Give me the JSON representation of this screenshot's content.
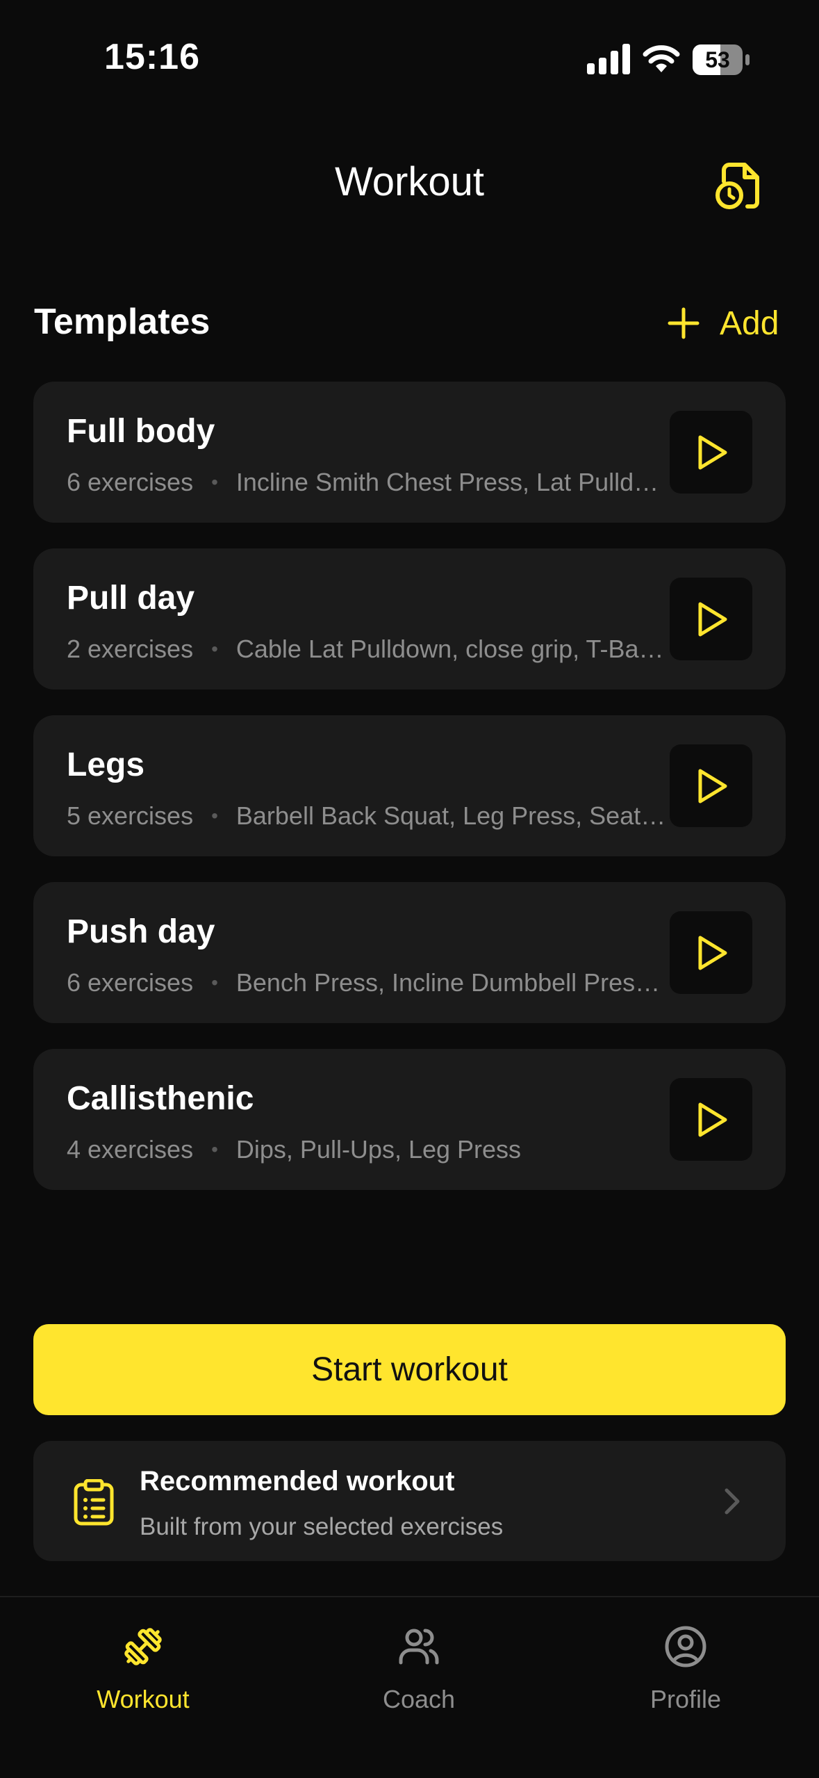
{
  "status_bar": {
    "time": "15:16",
    "battery_level": "53"
  },
  "header": {
    "title": "Workout",
    "history_icon": "file-clock-icon"
  },
  "templates_section": {
    "title": "Templates",
    "add_label": "Add"
  },
  "templates": [
    {
      "name": "Full body",
      "count": "6 exercises",
      "exercises": "Incline Smith Chest Press, Lat Pulldown, Barbell Back Squat, Seated Row, Shoulder Press, Leg Press"
    },
    {
      "name": "Pull day",
      "count": "2 exercises",
      "exercises": "Cable Lat Pulldown, close grip, T-Bar Row"
    },
    {
      "name": "Legs",
      "count": "5 exercises",
      "exercises": "Barbell Back Squat, Leg Press, Seated Leg Curl, Leg Extension, Calf Raise"
    },
    {
      "name": "Push day",
      "count": "6 exercises",
      "exercises": "Bench Press, Incline Dumbbell Press, Shoulder Press, Lateral Raise, Cable Fly, Triceps Pushdown"
    },
    {
      "name": "Callisthenic",
      "count": "4 exercises",
      "exercises": "Dips, Pull-Ups, Leg Press"
    }
  ],
  "start_workout_label": "Start workout",
  "recommended": {
    "title": "Recommended workout",
    "subtitle": "Built from your selected exercises",
    "icon": "clipboard-list-icon"
  },
  "tab_bar": {
    "tabs": [
      {
        "label": "Workout",
        "icon": "dumbbell-icon",
        "active": true
      },
      {
        "label": "Coach",
        "icon": "users-icon",
        "active": false
      },
      {
        "label": "Profile",
        "icon": "user-circle-icon",
        "active": false
      }
    ]
  },
  "colors": {
    "accent": "#ffe52e",
    "background": "#0b0b0b",
    "card": "#1b1b1b",
    "muted_text": "#8e8e8e"
  }
}
